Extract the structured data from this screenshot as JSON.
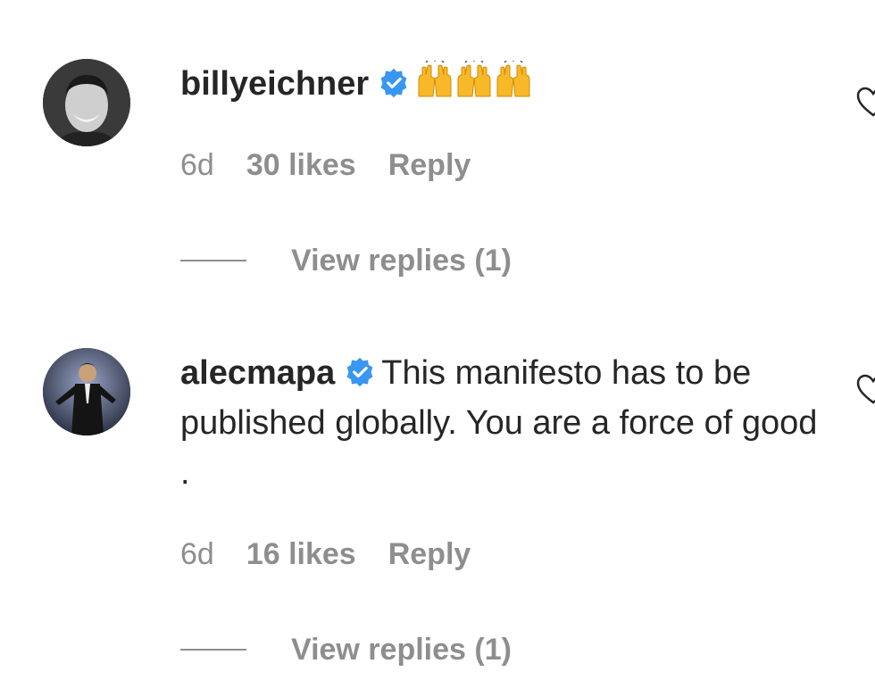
{
  "comments": [
    {
      "username": "billyeichner",
      "verified": true,
      "text": "",
      "emoji": "raising-hands-emoji-x3",
      "time": "6d",
      "likes": "30 likes",
      "reply": "Reply",
      "view_replies": "View replies (1)",
      "like_icon": "heart-outline-icon"
    },
    {
      "username": "alecmapa",
      "verified": true,
      "text": "This manifesto has to be published globally. You are a force of good .",
      "time": "6d",
      "likes": "16 likes",
      "reply": "Reply",
      "view_replies": "View replies (1)",
      "like_icon": "heart-outline-icon"
    }
  ],
  "colors": {
    "text": "#262626",
    "secondary": "#8e8e8e",
    "verified_blue": "#3897f0",
    "emoji_yellow": "#f7b92a"
  }
}
